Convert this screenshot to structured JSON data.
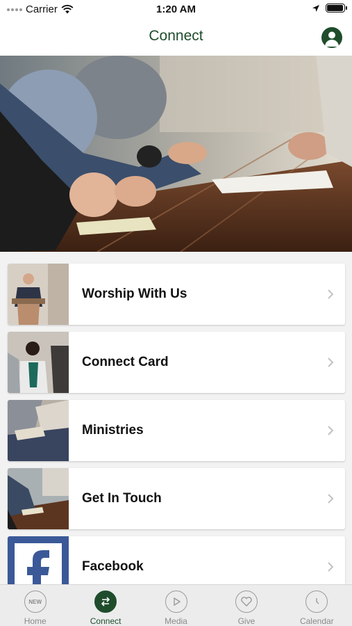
{
  "status_bar": {
    "carrier": "Carrier",
    "time": "1:20 AM",
    "battery_level": 0.95
  },
  "header": {
    "title": "Connect",
    "profile_icon": "person-icon"
  },
  "hero": {
    "description_icon": "meeting-photo"
  },
  "cards": [
    {
      "label": "Worship With Us",
      "thumb": "preacher-photo"
    },
    {
      "label": "Connect Card",
      "thumb": "people-talking-photo"
    },
    {
      "label": "Ministries",
      "thumb": "bible-study-photo"
    },
    {
      "label": "Get In Touch",
      "thumb": "group-table-photo"
    },
    {
      "label": "Facebook",
      "thumb": "facebook-logo"
    }
  ],
  "tabs": [
    {
      "label": "Home",
      "icon": "new-badge-icon",
      "badge": "NEW",
      "active": false
    },
    {
      "label": "Connect",
      "icon": "arrows-exchange-icon",
      "active": true
    },
    {
      "label": "Media",
      "icon": "play-icon",
      "active": false
    },
    {
      "label": "Give",
      "icon": "heart-icon",
      "active": false
    },
    {
      "label": "Calendar",
      "icon": "clock-icon",
      "active": false
    }
  ],
  "colors": {
    "brand_green": "#1f4d2c",
    "facebook_blue": "#3b5998",
    "tab_inactive": "#8a8a8a"
  }
}
